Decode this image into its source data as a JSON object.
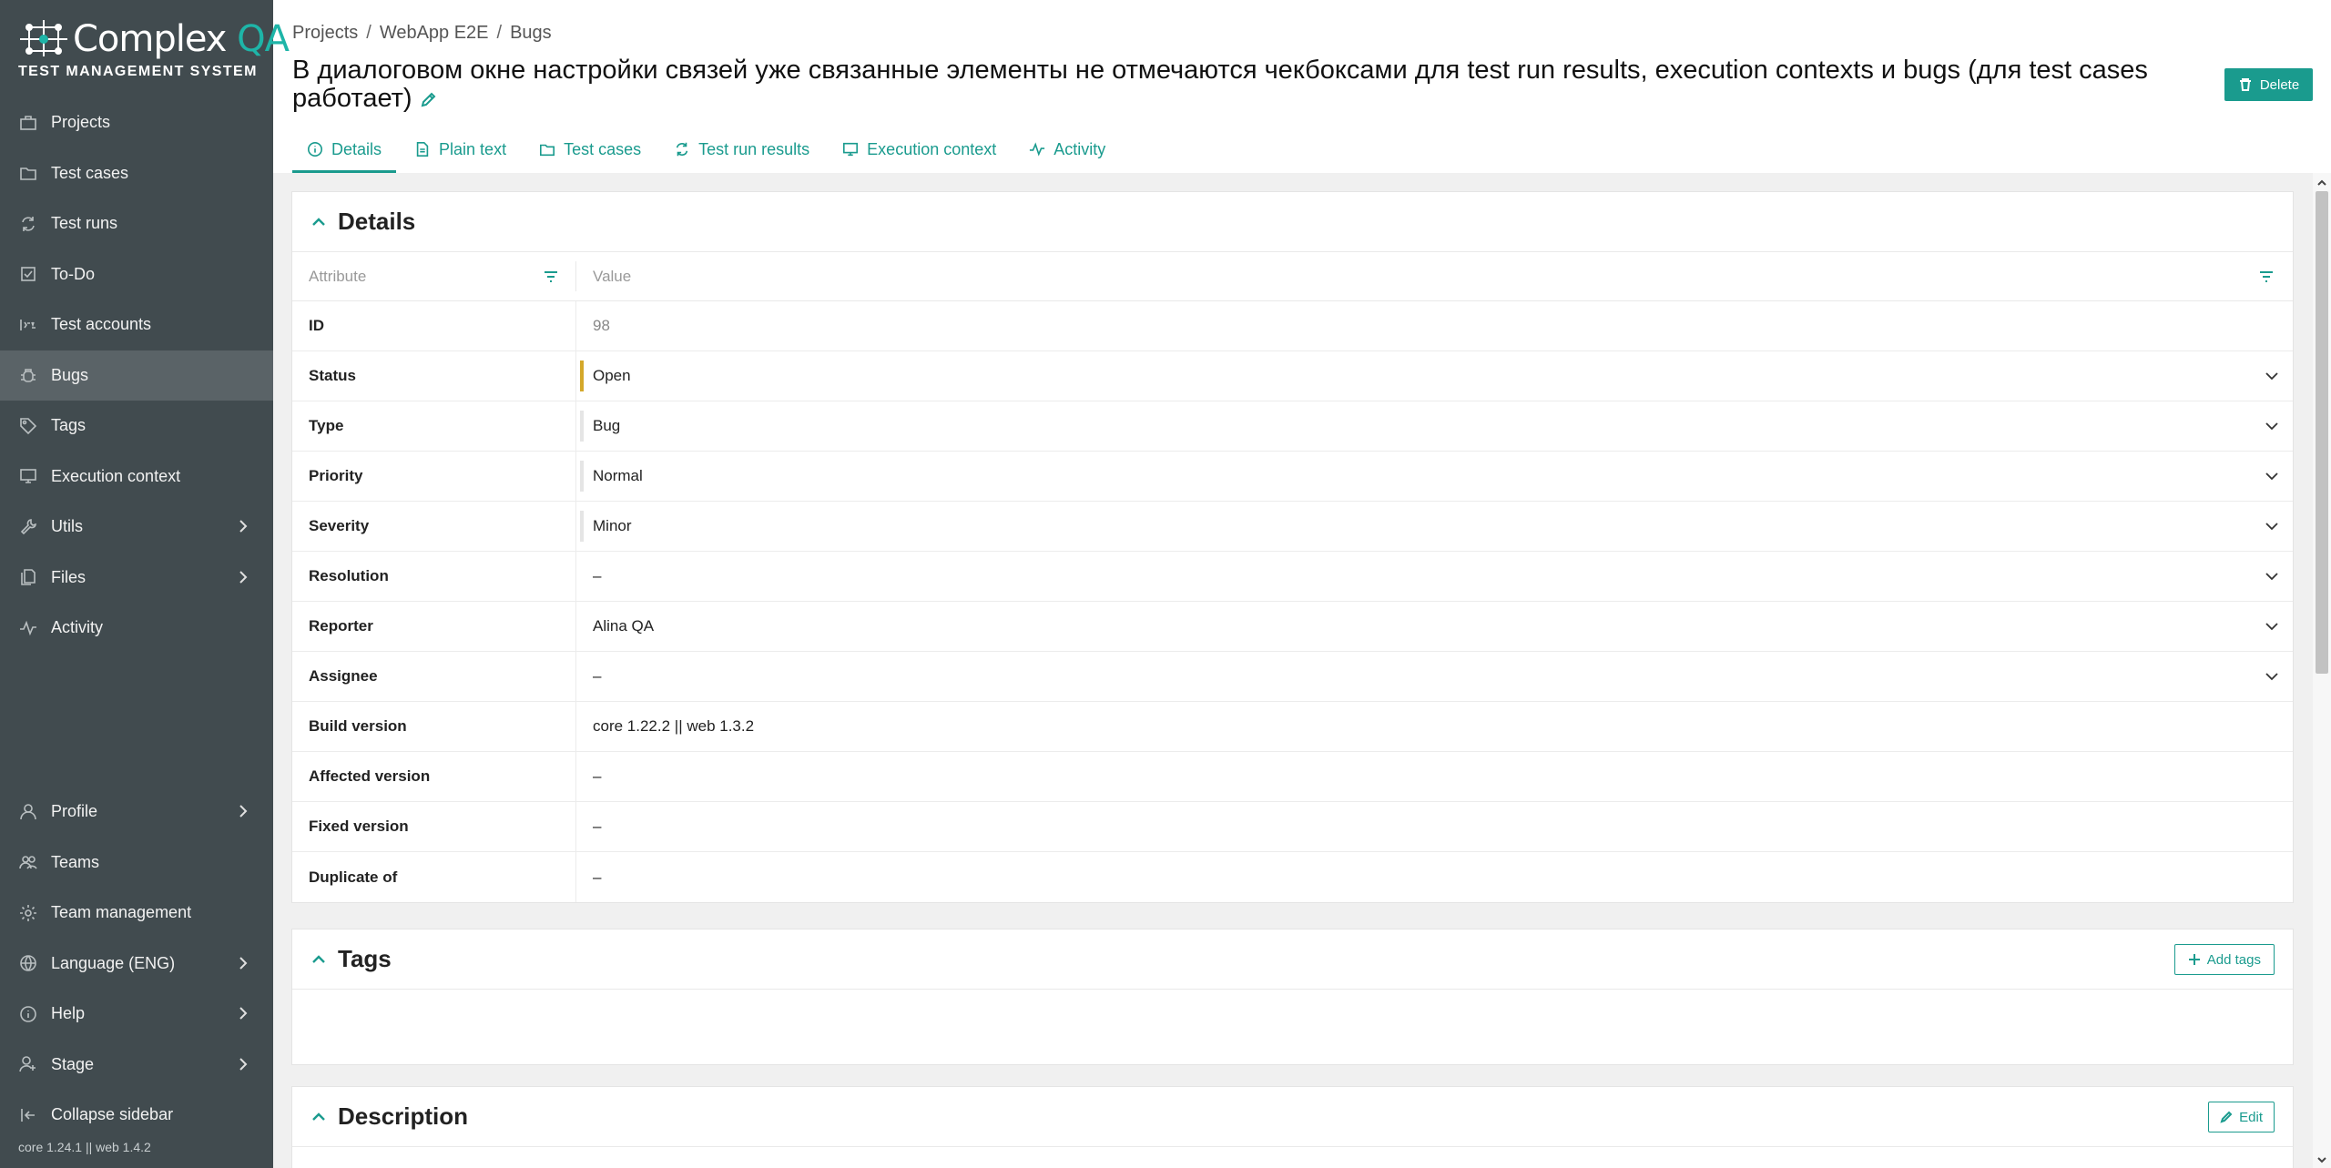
{
  "logo": {
    "brand_main": "Complex",
    "brand_accent": "QA",
    "tagline": "TEST MANAGEMENT SYSTEM"
  },
  "sidebar": {
    "items": [
      {
        "label": "Projects",
        "icon": "briefcase-icon"
      },
      {
        "label": "Test cases",
        "icon": "folder-icon"
      },
      {
        "label": "Test runs",
        "icon": "refresh-icon"
      },
      {
        "label": "To-Do",
        "icon": "checkbox-icon"
      },
      {
        "label": "Test accounts",
        "icon": "password-icon"
      },
      {
        "label": "Bugs",
        "icon": "bug-icon",
        "active": true
      },
      {
        "label": "Tags",
        "icon": "tag-icon"
      },
      {
        "label": "Execution context",
        "icon": "monitor-icon"
      },
      {
        "label": "Utils",
        "icon": "wrench-icon",
        "has_submenu": true
      },
      {
        "label": "Files",
        "icon": "files-icon",
        "has_submenu": true
      },
      {
        "label": "Activity",
        "icon": "activity-icon"
      }
    ],
    "bottom_items": [
      {
        "label": "Profile",
        "icon": "user-icon",
        "has_submenu": true
      },
      {
        "label": "Teams",
        "icon": "team-icon"
      },
      {
        "label": "Team management",
        "icon": "gear-icon"
      },
      {
        "label": "Language (ENG)",
        "icon": "globe-icon",
        "has_submenu": true
      },
      {
        "label": "Help",
        "icon": "info-icon",
        "has_submenu": true
      },
      {
        "label": "Stage",
        "icon": "user-stage-icon",
        "has_submenu": true
      },
      {
        "label": "Collapse sidebar",
        "icon": "collapse-icon"
      }
    ],
    "version": "core 1.24.1 || web 1.4.2"
  },
  "breadcrumb": [
    "Projects",
    "WebApp E2E",
    "Bugs"
  ],
  "title": "В диалоговом окне настройки связей уже связанные элементы не отмечаются чекбоксами для test run results, execution contexts и bugs (для test cases работает)",
  "delete_label": "Delete",
  "tabs": [
    {
      "label": "Details",
      "icon": "info-icon",
      "active": true
    },
    {
      "label": "Plain text",
      "icon": "document-icon"
    },
    {
      "label": "Test cases",
      "icon": "folder-icon"
    },
    {
      "label": "Test run results",
      "icon": "refresh-icon"
    },
    {
      "label": "Execution context",
      "icon": "monitor-icon"
    },
    {
      "label": "Activity",
      "icon": "activity-icon"
    }
  ],
  "details": {
    "heading": "Details",
    "col_attribute": "Attribute",
    "col_value": "Value",
    "rows": [
      {
        "attr": "ID",
        "value": "98",
        "muted": true
      },
      {
        "attr": "Status",
        "value": "Open",
        "dropdown": true,
        "bar": "open"
      },
      {
        "attr": "Type",
        "value": "Bug",
        "dropdown": true,
        "bar": "plain"
      },
      {
        "attr": "Priority",
        "value": "Normal",
        "dropdown": true,
        "bar": "plain"
      },
      {
        "attr": "Severity",
        "value": "Minor",
        "dropdown": true,
        "bar": "plain"
      },
      {
        "attr": "Resolution",
        "value": "–",
        "dropdown": true
      },
      {
        "attr": "Reporter",
        "value": "Alina QA",
        "dropdown": true
      },
      {
        "attr": "Assignee",
        "value": "–",
        "dropdown": true
      },
      {
        "attr": "Build version",
        "value": "core 1.22.2 || web 1.3.2"
      },
      {
        "attr": "Affected version",
        "value": "–"
      },
      {
        "attr": "Fixed version",
        "value": "–"
      },
      {
        "attr": "Duplicate of",
        "value": "–"
      }
    ]
  },
  "tags": {
    "heading": "Tags",
    "add_label": "Add tags"
  },
  "description": {
    "heading": "Description",
    "edit_label": "Edit"
  },
  "colors": {
    "accent": "#1a9b8e",
    "sidebar_bg": "#414b4f",
    "status_open": "#d4a82a"
  }
}
